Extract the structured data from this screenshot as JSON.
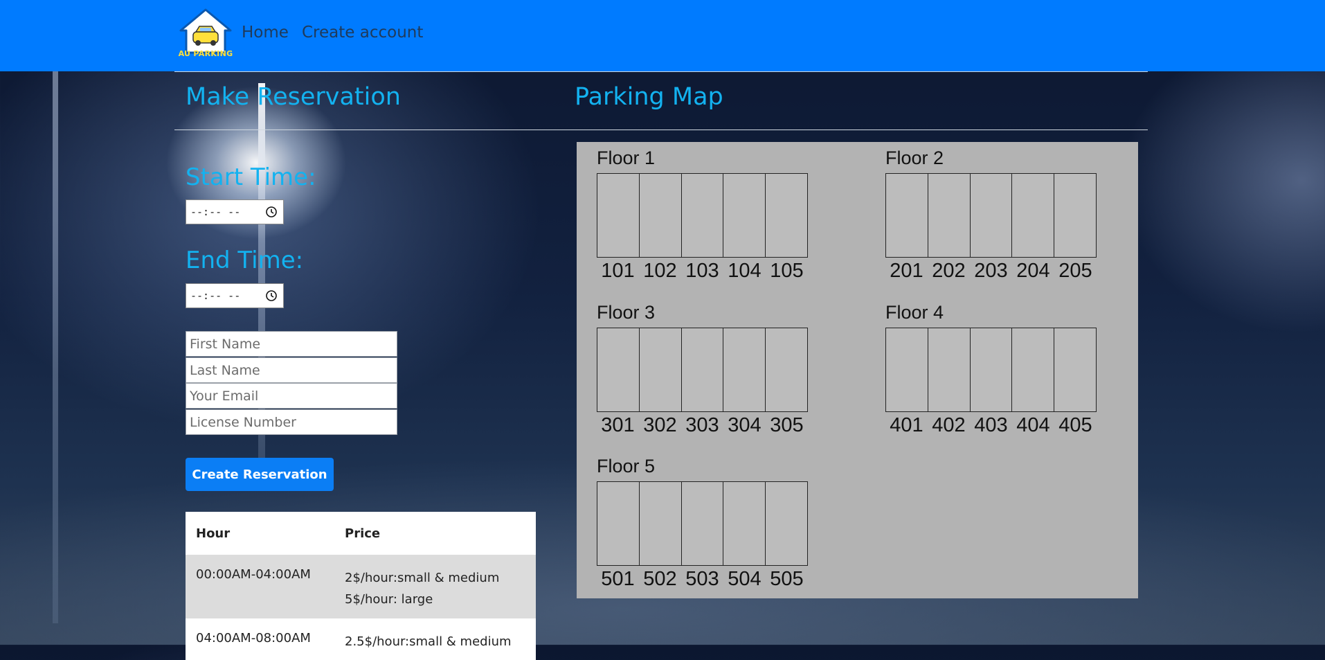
{
  "navbar": {
    "logo_text": "AU PARKING",
    "links": [
      "Home",
      "Create account"
    ]
  },
  "sections": {
    "reservation_title": "Make Reservation",
    "map_title": "Parking Map"
  },
  "form": {
    "start_label": "Start Time:",
    "start_value": "--:-- --",
    "end_label": "End Time:",
    "end_value": "--:-- --",
    "first_name_placeholder": "First Name",
    "last_name_placeholder": "Last Name",
    "email_placeholder": "Your Email",
    "license_placeholder": "License Number",
    "submit_label": "Create Reservation"
  },
  "price_table": {
    "headers": [
      "Hour",
      "Price"
    ],
    "rows": [
      {
        "hour": "00:00AM-04:00AM",
        "price_line1": "2$/hour:small & medium",
        "price_line2": "5$/hour: large"
      },
      {
        "hour": "04:00AM-08:00AM",
        "price_line1": "2.5$/hour:small & medium"
      }
    ]
  },
  "parking_map": {
    "floors": [
      {
        "label": "Floor 1",
        "spots": [
          "101",
          "102",
          "103",
          "104",
          "105"
        ]
      },
      {
        "label": "Floor 2",
        "spots": [
          "201",
          "202",
          "203",
          "204",
          "205"
        ]
      },
      {
        "label": "Floor 3",
        "spots": [
          "301",
          "302",
          "303",
          "304",
          "305"
        ]
      },
      {
        "label": "Floor 4",
        "spots": [
          "401",
          "402",
          "403",
          "404",
          "405"
        ]
      },
      {
        "label": "Floor 5",
        "spots": [
          "501",
          "502",
          "503",
          "504",
          "505"
        ]
      }
    ]
  },
  "colors": {
    "navbar": "#007bff",
    "accent_text": "#13b2f0",
    "button": "#0b7ef5",
    "map_panel": "#b3b3b3",
    "logo_yellow": "#ffe03a"
  },
  "icons": {
    "logo": "house-car-icon",
    "time_picker": "clock-icon"
  }
}
